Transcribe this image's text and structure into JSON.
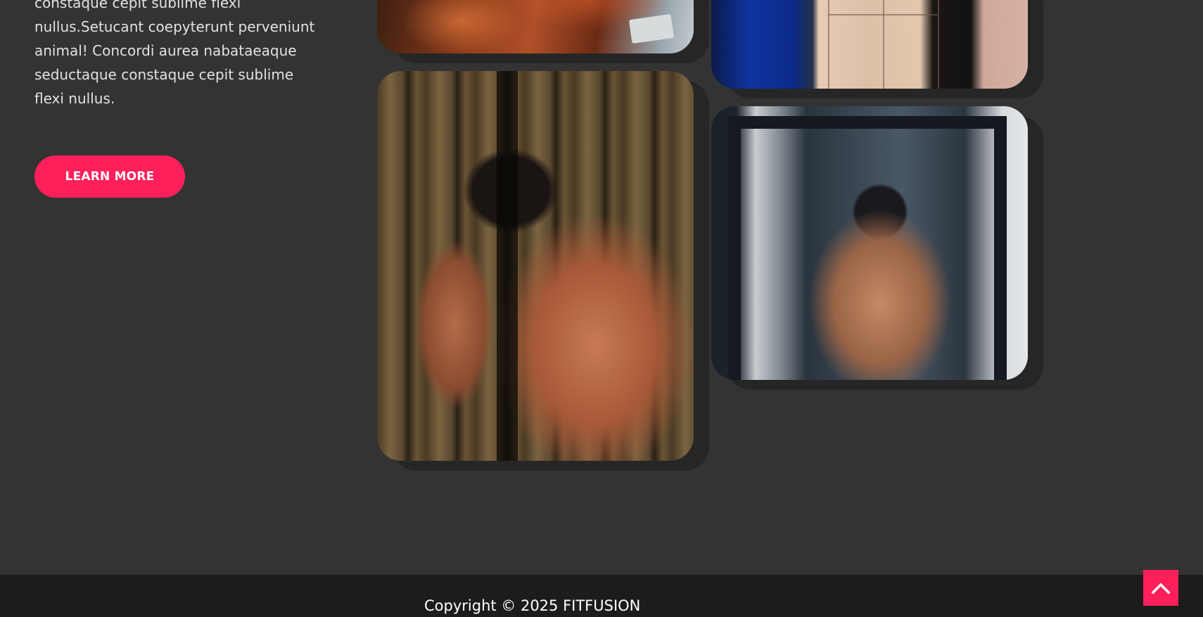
{
  "about": {
    "paragraph": "constaque cepit sublime flexi nullus.Setucant coepyterunt perveniunt animal! Concordi aurea nabataeaque seductaque constaque cepit sublime flexi nullus.",
    "button_label": "LEARN MORE"
  },
  "gallery": {
    "images": [
      {
        "name": "arm-flex-photo"
      },
      {
        "name": "locker-room-photo"
      },
      {
        "name": "curtain-pose-photo"
      },
      {
        "name": "mirror-back-photo"
      }
    ]
  },
  "footer": {
    "copyright": "Copyright © 2025 FITFUSION"
  },
  "colors": {
    "accent": "#ff1f5a",
    "background": "#333333",
    "footer": "#1c1c1c"
  },
  "icons": {
    "scroll_top": "chevron-up-icon"
  }
}
